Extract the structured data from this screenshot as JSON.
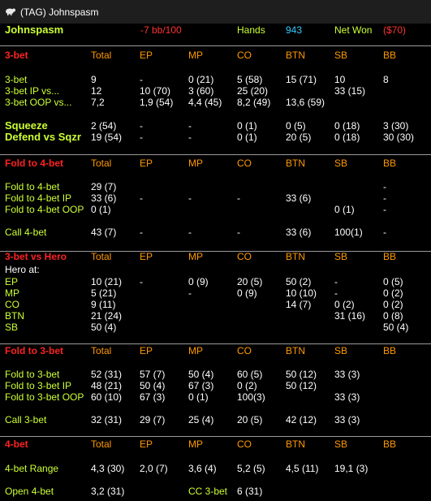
{
  "window": {
    "title": "(TAG) Johnspasm"
  },
  "header": {
    "player": "Johnspasm",
    "winrate": "-7 bb/100",
    "hands_label": "Hands",
    "hands": "943",
    "netwon_label": "Net Won",
    "netwon": "($70)"
  },
  "cols": [
    "Total",
    "EP",
    "MP",
    "CO",
    "BTN",
    "SB",
    "BB"
  ],
  "s1": {
    "title": "3-bet",
    "rows": [
      [
        "3-bet",
        "9",
        "-",
        "0 (21)",
        "5 (58)",
        "15 (71)",
        "10",
        "8"
      ],
      [
        "3-bet IP vs...",
        "12",
        "10 (70)",
        "3 (60)",
        "25 (20)",
        "",
        "33 (15)",
        ""
      ],
      [
        "3-bet OOP vs...",
        "7,2",
        "1,9 (54)",
        "4,4 (45)",
        "8,2 (49)",
        "13,6 (59)",
        "",
        ""
      ]
    ],
    "rows2": [
      [
        "Squeeze",
        "2 (54)",
        "-",
        "-",
        "0 (1)",
        "0 (5)",
        "0 (18)",
        "3 (30)"
      ],
      [
        "Defend vs Sqzr",
        "19 (54)",
        "-",
        "-",
        "0 (1)",
        "20 (5)",
        "0 (18)",
        "30 (30)"
      ]
    ]
  },
  "s2": {
    "title": "Fold to 4-bet",
    "rows": [
      [
        "Fold to 4-bet",
        "29 (7)",
        "",
        "",
        "",
        "",
        "",
        "-"
      ],
      [
        "Fold to 4-bet IP",
        "33 (6)",
        "-",
        "-",
        "-",
        "33 (6)",
        "",
        "-"
      ],
      [
        "Fold to 4-bet OOP",
        "0 (1)",
        "",
        "",
        "",
        "",
        "0 (1)",
        "-"
      ]
    ],
    "rows2": [
      [
        "Call 4-bet",
        "43 (7)",
        "-",
        "-",
        "-",
        "33 (6)",
        "100(1)",
        "-"
      ]
    ]
  },
  "s3": {
    "title": "3-bet vs Hero",
    "hero_at": "Hero at:",
    "rows": [
      [
        "EP",
        "10 (21)",
        "-",
        "0 (9)",
        "20 (5)",
        "50 (2)",
        "-",
        "0 (5)"
      ],
      [
        "MP",
        "5 (21)",
        "",
        "-",
        "0 (9)",
        "10 (10)",
        "-",
        "0 (2)"
      ],
      [
        "CO",
        "9 (11)",
        "",
        "",
        "",
        "14 (7)",
        "0 (2)",
        "0 (2)"
      ],
      [
        "BTN",
        "21 (24)",
        "",
        "",
        "",
        "",
        "31 (16)",
        "0 (8)"
      ],
      [
        "SB",
        "50 (4)",
        "",
        "",
        "",
        "",
        "",
        "50 (4)"
      ]
    ]
  },
  "s4": {
    "title": "Fold to 3-bet",
    "rows": [
      [
        "Fold to 3-bet",
        "52 (31)",
        "57 (7)",
        "50 (4)",
        "60 (5)",
        "50 (12)",
        "33 (3)",
        ""
      ],
      [
        "Fold to 3-bet IP",
        "48 (21)",
        "50 (4)",
        "67 (3)",
        "0 (2)",
        "50 (12)",
        "",
        ""
      ],
      [
        "Fold to 3-bet OOP",
        "60 (10)",
        "67 (3)",
        "0 (1)",
        "100(3)",
        "",
        "33 (3)",
        ""
      ]
    ],
    "rows2": [
      [
        "Call 3-bet",
        "32 (31)",
        "29 (7)",
        "25 (4)",
        "20 (5)",
        "42 (12)",
        "33 (3)",
        ""
      ]
    ]
  },
  "s5": {
    "title": "4-bet",
    "rows": [
      [
        "4-bet Range",
        "4,3 (30)",
        "2,0 (7)",
        "3,6 (4)",
        "5,2 (5)",
        "4,5 (11)",
        "19,1 (3)",
        ""
      ]
    ],
    "open_label": "Open 4-bet",
    "open_value": "3,2 (31)",
    "cc_label": "CC 3-bet",
    "cc_value": "6 (31)"
  },
  "colors": {
    "label": "#ccff33",
    "header": "#ff9900",
    "section": "#ff2222",
    "value": "#ffffff",
    "hands": "#33ccff"
  },
  "icons": [
    "app-icon"
  ]
}
